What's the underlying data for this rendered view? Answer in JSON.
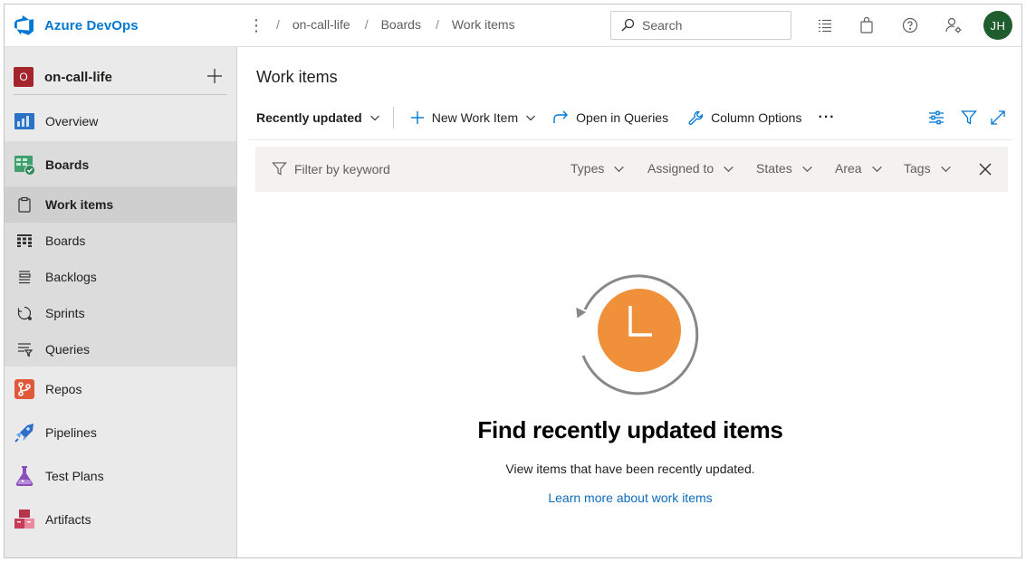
{
  "app": {
    "name": "Azure DevOps",
    "brand_color": "#0078d4"
  },
  "breadcrumb": {
    "items": [
      "on-call-life",
      "Boards",
      "Work items"
    ]
  },
  "search": {
    "placeholder": "Search"
  },
  "user": {
    "initials": "JH",
    "avatar_color": "#1f5c2e"
  },
  "sidebar": {
    "project": {
      "initial": "O",
      "name": "on-call-life",
      "badge_color": "#a4262c"
    },
    "items": [
      {
        "label": "Overview",
        "icon": "overview-icon"
      },
      {
        "label": "Boards",
        "icon": "boards-hub-icon"
      },
      {
        "label": "Work items",
        "icon": "work-items-icon",
        "selected": true
      },
      {
        "label": "Boards",
        "icon": "kanban-board-icon"
      },
      {
        "label": "Backlogs",
        "icon": "backlog-icon"
      },
      {
        "label": "Sprints",
        "icon": "sprint-icon"
      },
      {
        "label": "Queries",
        "icon": "query-icon"
      },
      {
        "label": "Repos",
        "icon": "repos-icon"
      },
      {
        "label": "Pipelines",
        "icon": "pipelines-icon"
      },
      {
        "label": "Test Plans",
        "icon": "test-plans-icon"
      },
      {
        "label": "Artifacts",
        "icon": "artifacts-icon"
      }
    ]
  },
  "main": {
    "title": "Work items",
    "toolbar": {
      "view_selector": "Recently updated",
      "new_work_item": "New Work Item",
      "open_in_queries": "Open in Queries",
      "column_options": "Column Options",
      "more": "···"
    },
    "filter": {
      "placeholder": "Filter by keyword",
      "dropdowns": [
        "Types",
        "Assigned to",
        "States",
        "Area",
        "Tags"
      ]
    },
    "empty_state": {
      "title": "Find recently updated items",
      "subtitle": "View items that have been recently updated.",
      "link": "Learn more about work items",
      "clock_color": "#f0903a"
    }
  }
}
